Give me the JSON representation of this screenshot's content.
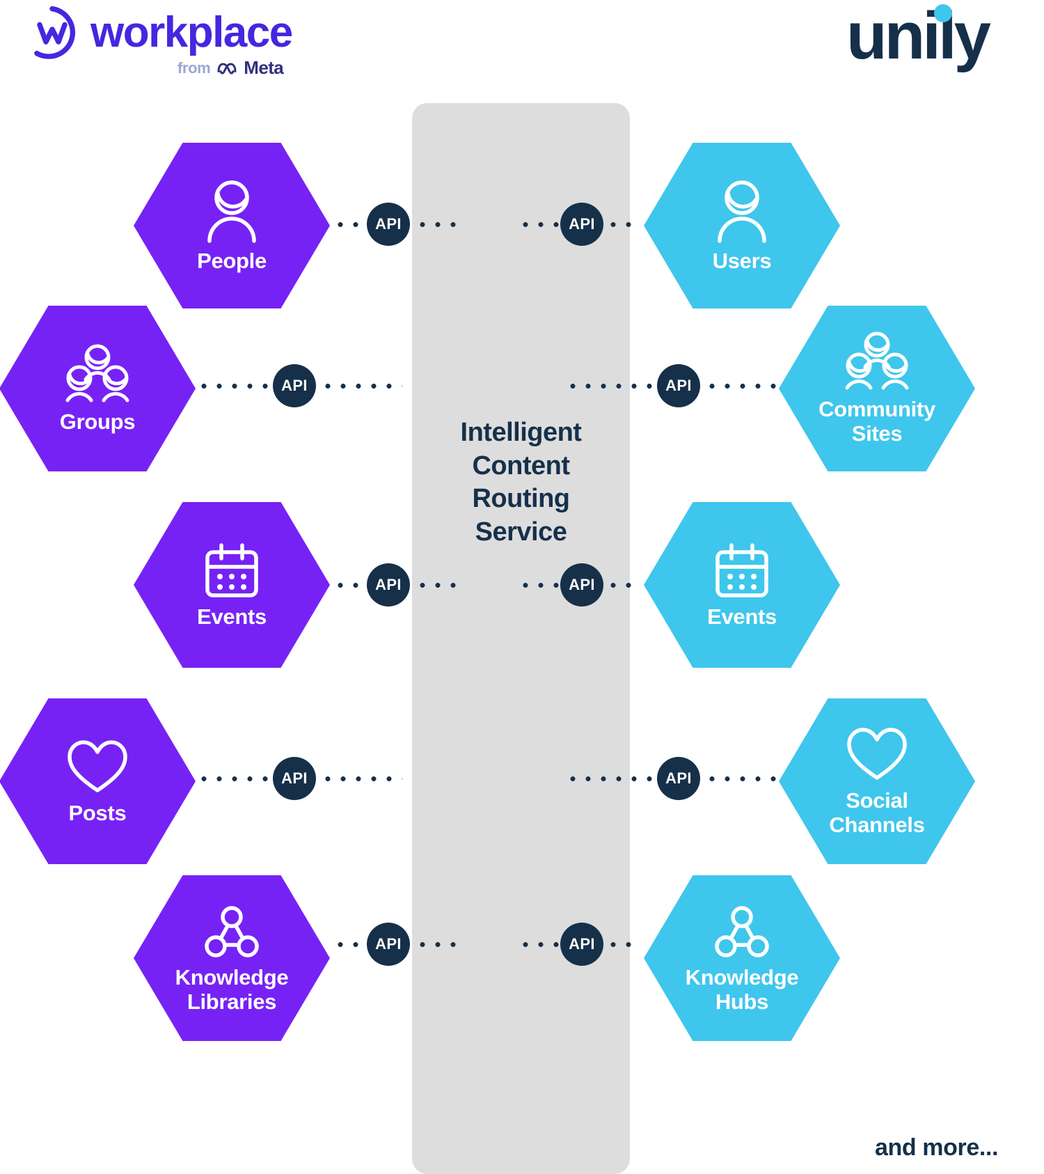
{
  "brand": {
    "workplace_word": "workplace",
    "workplace_from": "from",
    "workplace_meta": "Meta",
    "unily_word": "unily"
  },
  "colors": {
    "purple": "#7722F5",
    "blue": "#3FC6EC",
    "navy": "#16304a",
    "panel_gray": "#dddddd",
    "workplace_violet": "#4527E0"
  },
  "center": {
    "title": "Intelligent\nContent\nRouting\nService"
  },
  "footer": {
    "and_more": "and more..."
  },
  "api_label": "API",
  "left_nodes": [
    {
      "label": "People",
      "icon": "person-icon"
    },
    {
      "label": "Groups",
      "icon": "three-people-icon"
    },
    {
      "label": "Events",
      "icon": "calendar-icon"
    },
    {
      "label": "Posts",
      "icon": "heart-icon"
    },
    {
      "label": "Knowledge\nLibraries",
      "icon": "network-triangle-icon"
    }
  ],
  "right_nodes": [
    {
      "label": "Users",
      "icon": "person-icon"
    },
    {
      "label": "Community\nSites",
      "icon": "three-people-icon"
    },
    {
      "label": "Events",
      "icon": "calendar-icon"
    },
    {
      "label": "Social\nChannels",
      "icon": "heart-icon"
    },
    {
      "label": "Knowledge\nHubs",
      "icon": "network-triangle-icon"
    }
  ],
  "api_chips": [
    {
      "side": "left",
      "row": "people"
    },
    {
      "side": "right",
      "row": "users"
    },
    {
      "side": "left",
      "row": "groups"
    },
    {
      "side": "right",
      "row": "community-sites"
    },
    {
      "side": "left",
      "row": "events"
    },
    {
      "side": "right",
      "row": "events"
    },
    {
      "side": "left",
      "row": "posts"
    },
    {
      "side": "right",
      "row": "social-channels"
    },
    {
      "side": "left",
      "row": "knowledge-libraries"
    },
    {
      "side": "right",
      "row": "knowledge-hubs"
    }
  ]
}
